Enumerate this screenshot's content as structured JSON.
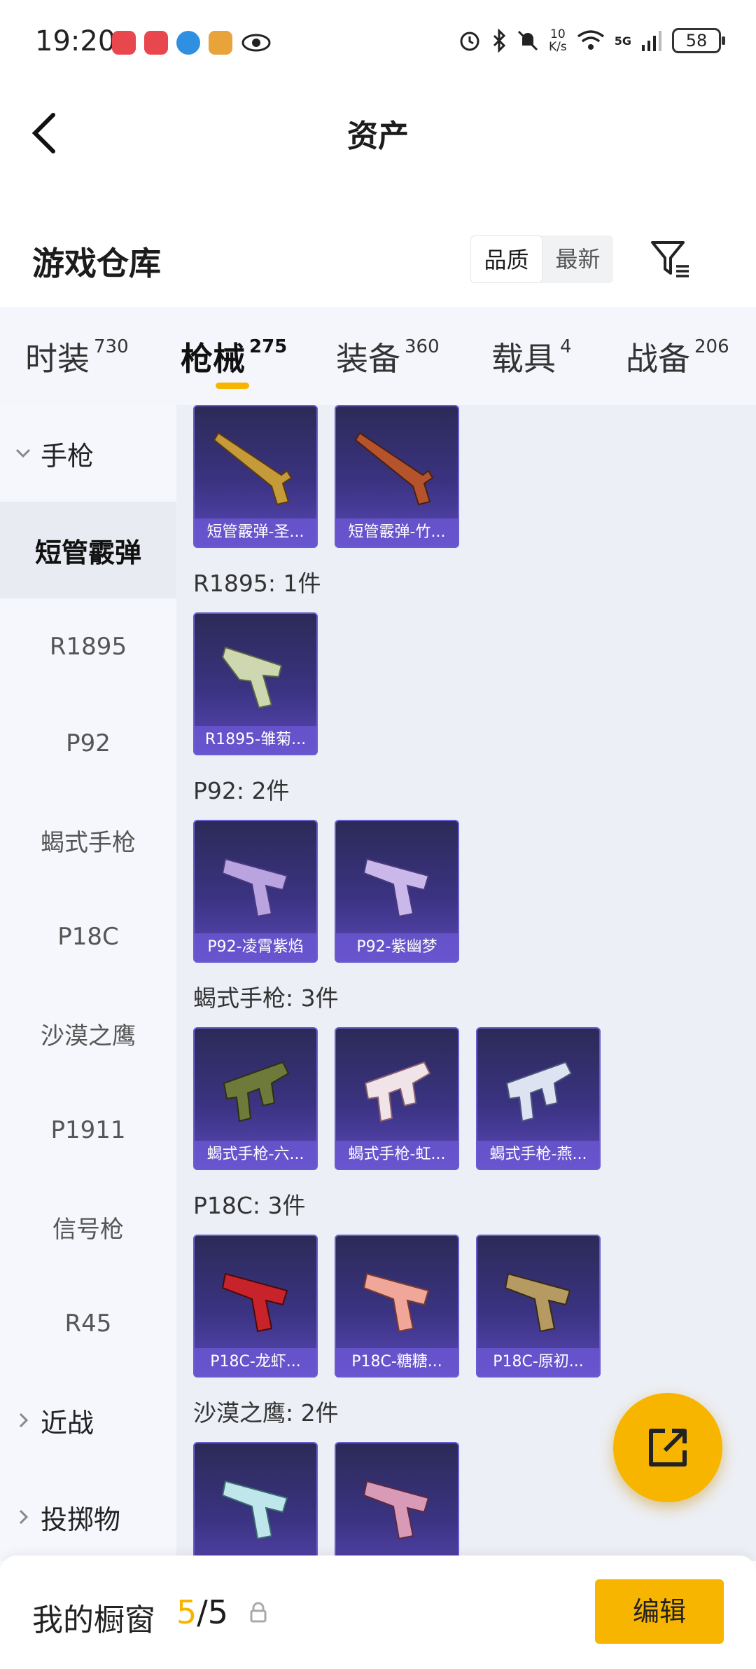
{
  "status_bar": {
    "time": "19:20",
    "net_speed_top": "10",
    "net_speed_bottom": "K/s",
    "signal_label": "5G",
    "battery": "58"
  },
  "header": {
    "title": "资产"
  },
  "warehouse": {
    "title": "游戏仓库",
    "sort_options": [
      "品质",
      "最新"
    ],
    "active_sort": "品质"
  },
  "tabs": [
    {
      "label": "时装",
      "count": "730"
    },
    {
      "label": "枪械",
      "count": "275"
    },
    {
      "label": "装备",
      "count": "360"
    },
    {
      "label": "载具",
      "count": "4"
    },
    {
      "label": "战备",
      "count": "206"
    }
  ],
  "active_tab": "枪械",
  "sidebar": {
    "group_pistol": "手枪",
    "items": [
      "短管霰弹",
      "R1895",
      "P92",
      "蝎式手枪",
      "P18C",
      "沙漠之鹰",
      "P1911",
      "信号枪",
      "R45"
    ],
    "active_item": "短管霰弹",
    "group_melee": "近战",
    "group_throw": "投掷物"
  },
  "groups": [
    {
      "label": "",
      "items": [
        "短管霰弹-圣...",
        "短管霰弹-竹..."
      ]
    },
    {
      "label": "R1895: 1件",
      "items": [
        "R1895-雏菊..."
      ]
    },
    {
      "label": "P92: 2件",
      "items": [
        "P92-凌霄紫焰",
        "P92-紫幽梦"
      ]
    },
    {
      "label": "蝎式手枪: 3件",
      "items": [
        "蝎式手枪-六...",
        "蝎式手枪-虹...",
        "蝎式手枪-燕..."
      ]
    },
    {
      "label": "P18C: 3件",
      "items": [
        "P18C-龙虾...",
        "P18C-糖糖...",
        "P18C-原初..."
      ]
    },
    {
      "label": "沙漠之鹰: 2件",
      "items": [
        "",
        ""
      ]
    }
  ],
  "bottom": {
    "showcase_label": "我的橱窗",
    "current": "5",
    "total": "/5",
    "edit_label": "编辑"
  },
  "colors": {
    "accent": "#f7b500",
    "card_top": "#2c2a58",
    "card_bottom": "#5a48b8"
  }
}
